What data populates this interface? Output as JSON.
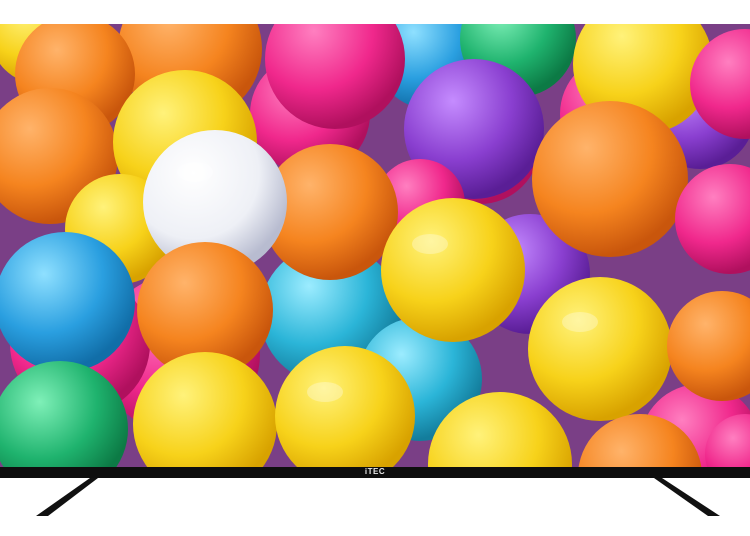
{
  "product": {
    "brand_logo": "iTEC"
  },
  "screen": {
    "scene": "colorful-ball-pit",
    "colors": {
      "orange": "#f5841f",
      "yellow": "#f7d21a",
      "pink": "#f0288c",
      "purple": "#8a3fd0",
      "blue": "#2a9fe0",
      "green": "#1fb36e",
      "white": "#eef0f6",
      "cyan": "#2bb5d8"
    }
  }
}
